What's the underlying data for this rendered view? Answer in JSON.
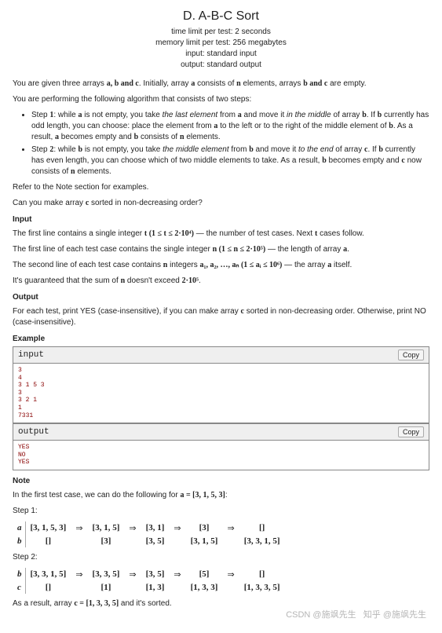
{
  "header": {
    "title": "D. A-B-C Sort",
    "time_limit": "time limit per test: 2 seconds",
    "memory_limit": "memory limit per test: 256 megabytes",
    "input": "input: standard input",
    "output": "output: standard output"
  },
  "statement": {
    "p1_a": "You are given three arrays ",
    "p1_b": ". Initially, array ",
    "p1_c": " consists of ",
    "p1_d": " elements, arrays ",
    "p1_e": " are empty.",
    "p2": "You are performing the following algorithm that consists of two steps:",
    "step1_a": "Step ",
    "step1_b": ": while ",
    "step1_c": " is not empty, you take ",
    "step1_d": "the last element",
    "step1_e": " from ",
    "step1_f": " and move it ",
    "step1_g": "in the middle",
    "step1_h": " of array ",
    "step1_i": ". If ",
    "step1_j": " currently has odd length, you can choose: place the element from ",
    "step1_k": " to the left or to the right of the middle element of ",
    "step1_l": ". As a result, ",
    "step1_m": " becomes empty and ",
    "step1_n": " consists of ",
    "step1_o": " elements.",
    "step2_a": "Step ",
    "step2_b": ": while ",
    "step2_c": " is not empty, you take ",
    "step2_d": "the middle element",
    "step2_e": " from ",
    "step2_f": " and move it ",
    "step2_g": "to the end",
    "step2_h": " of array ",
    "step2_i": ". If ",
    "step2_j": " currently has even length, you can choose which of two middle elements to take. As a result, ",
    "step2_k": " becomes empty and ",
    "step2_l": " now consists of ",
    "step2_m": " elements.",
    "p3": "Refer to the Note section for examples.",
    "p4_a": "Can you make array ",
    "p4_b": " sorted in non-decreasing order?"
  },
  "input_section": {
    "title": "Input",
    "p1_a": "The first line contains a single integer ",
    "p1_b": " — the number of test cases. Next ",
    "p1_c": " cases follow.",
    "p2_a": "The first line of each test case contains the single integer ",
    "p2_b": " — the length of array ",
    "p2_c": ".",
    "p3_a": "The second line of each test case contains ",
    "p3_b": " integers ",
    "p3_c": " — the array ",
    "p3_d": " itself.",
    "p4_a": "It's guaranteed that the sum of ",
    "p4_b": " doesn't exceed ",
    "p4_c": "."
  },
  "math": {
    "a": "a",
    "b": "b",
    "c": "c",
    "n": "n",
    "t": "t",
    "abc": "a, b and c",
    "band_c": "b and c",
    "one": "1",
    "two": "2",
    "t_range": "t (1 ≤ t ≤ 2·10⁴)",
    "n_range": "n (1 ≤ n ≤ 2·10⁵)",
    "a_list": "a₁, a₂, …, aₙ (1 ≤ aᵢ ≤ 10⁶)",
    "sum_n": "2·10⁵",
    "arr_c": "c = [1, 3, 3, 5]",
    "arr_a": "a = [3, 1, 5, 3]"
  },
  "output_section": {
    "title": "Output",
    "p1_a": "For each test, print ",
    "p1_b": " (case-insensitive), if you can make array ",
    "p1_c": " sorted in non-decreasing order. Otherwise, print ",
    "p1_d": " (case-insensitive).",
    "yes": "YES",
    "no": "NO"
  },
  "example": {
    "title": "Example",
    "input_label": "input",
    "output_label": "output",
    "copy": "Copy",
    "input_text": "3\n4\n3 1 5 3\n3\n3 2 1\n1\n7331",
    "output_text": "YES\nNO\nYES"
  },
  "note": {
    "title": "Note",
    "p1_a": "In the first test case, we can do the following for ",
    "p1_b": ":",
    "step1_label": "Step 1:",
    "step2_label": "Step 2:",
    "end_a": "As a result, array ",
    "end_b": " and it's sorted."
  },
  "step1_table": {
    "row_a": [
      "[3, 1, 5, 3]",
      "[3, 1, 5]",
      "[3, 1]",
      "[3]",
      "[]"
    ],
    "row_b": [
      "[]",
      "[3]",
      "[3, 5]",
      "[3, 1, 5]",
      "[3, 3, 1, 5]"
    ]
  },
  "step2_table": {
    "row_b": [
      "[3, 3, 1, 5]",
      "[3, 3, 5]",
      "[3, 5]",
      "[5]",
      "[]"
    ],
    "row_c": [
      "[]",
      "[1]",
      "[1, 3]",
      "[1, 3, 3]",
      "[1, 3, 3, 5]"
    ]
  },
  "watermark": {
    "csdn": "CSDN @施飒先生",
    "zhihu": "知乎 @施飒先生"
  }
}
